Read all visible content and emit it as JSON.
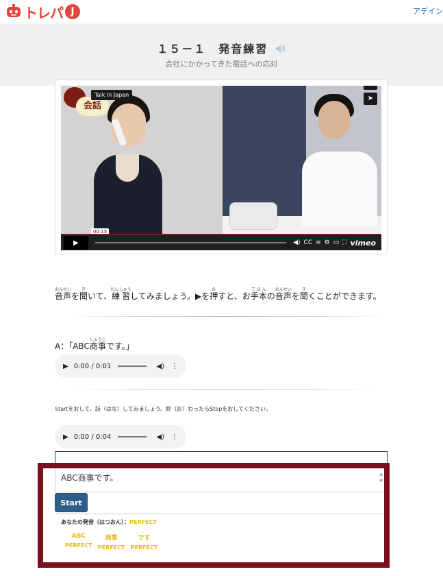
{
  "header": {
    "logo_text": "トレパ",
    "logo_letter": "J",
    "nav_text": "アデイン"
  },
  "lesson": {
    "title": "１５－１　発音練習",
    "subtitle": "会社にかかってきた電話への応対"
  },
  "video": {
    "badge_text": "会話",
    "tag": "Talk In Japan",
    "time_tooltip": "00:15",
    "brand": "vimeo"
  },
  "instruction": {
    "w1": "音声",
    "w1_ruby": "おんせい",
    "t1": "を",
    "w2": "聞",
    "w2_ruby": "き",
    "t2": "いて、",
    "w3": "練習",
    "w3_ruby": "れんしゅう",
    "t3": "してみましょう。▶を",
    "w4": "押",
    "w4_ruby": "お",
    "t4": "すと、お",
    "w5": "手本",
    "w5_ruby": "てほん",
    "t5": "の",
    "w6": "音声",
    "w6_ruby": "おんせい",
    "t6": "を",
    "w7": "聞",
    "w7_ruby": "き",
    "t7": "くことができます。"
  },
  "sentence": {
    "prefix": "A：「ABC",
    "word": "商事",
    "word_ruby": "しょうじ",
    "suffix": "です。」"
  },
  "audio1": {
    "time": "0:00 / 0:01"
  },
  "audio2": {
    "time": "0:00 / 0:04"
  },
  "note": "Startをおして、話（はな）してみましょう。終（お）わったらStopをおしてください。",
  "practice": {
    "textarea_value": "ABC商事です。",
    "start_label": "Start",
    "result_label": "あなたの発音（はつおん）：",
    "result_score": "PERFECT",
    "words": [
      {
        "word": "ABC",
        "score": "PERFECT"
      },
      {
        "word": "商事",
        "score": "PERFECT"
      },
      {
        "word": "です",
        "score": "PERFECT"
      }
    ]
  },
  "colors": {
    "brand_red": "#e2453c",
    "highlight": "#7b0f1f",
    "start_button": "#2e5f8a",
    "perfect": "#e8b91a"
  },
  "icons": {
    "speaker": "speaker-icon",
    "play": "play-icon",
    "volume": "volume-icon",
    "menu": "more-vertical-icon"
  }
}
